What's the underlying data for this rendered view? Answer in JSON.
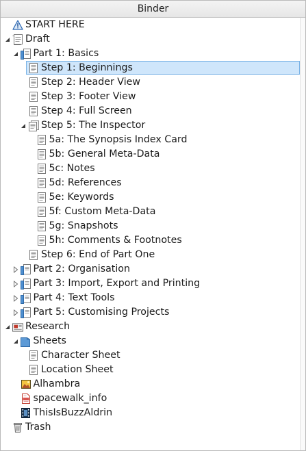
{
  "header": {
    "title": "Binder"
  },
  "items": [
    {
      "label": "START HERE",
      "depth": 0,
      "icon": "warning-icon",
      "toggle": "none"
    },
    {
      "label": "Draft",
      "depth": 0,
      "icon": "draft-icon",
      "toggle": "expanded"
    },
    {
      "label": "Part 1: Basics",
      "depth": 1,
      "icon": "folder-doc-icon",
      "toggle": "expanded"
    },
    {
      "label": "Step 1: Beginnings",
      "depth": 2,
      "icon": "document-icon",
      "toggle": "none",
      "selected": true
    },
    {
      "label": "Step 2: Header View",
      "depth": 2,
      "icon": "document-icon",
      "toggle": "none"
    },
    {
      "label": "Step 3: Footer View",
      "depth": 2,
      "icon": "document-icon",
      "toggle": "none"
    },
    {
      "label": "Step 4: Full Screen",
      "depth": 2,
      "icon": "document-icon",
      "toggle": "none"
    },
    {
      "label": "Step 5: The Inspector",
      "depth": 2,
      "icon": "document-stack-icon",
      "toggle": "expanded"
    },
    {
      "label": "5a: The Synopsis Index Card",
      "depth": 3,
      "icon": "document-icon",
      "toggle": "none"
    },
    {
      "label": "5b: General Meta-Data",
      "depth": 3,
      "icon": "document-icon",
      "toggle": "none"
    },
    {
      "label": "5c: Notes",
      "depth": 3,
      "icon": "document-icon",
      "toggle": "none"
    },
    {
      "label": "5d: References",
      "depth": 3,
      "icon": "document-icon",
      "toggle": "none"
    },
    {
      "label": "5e: Keywords",
      "depth": 3,
      "icon": "document-icon",
      "toggle": "none"
    },
    {
      "label": "5f: Custom Meta-Data",
      "depth": 3,
      "icon": "document-icon",
      "toggle": "none"
    },
    {
      "label": "5g: Snapshots",
      "depth": 3,
      "icon": "document-icon",
      "toggle": "none"
    },
    {
      "label": "5h: Comments & Footnotes",
      "depth": 3,
      "icon": "document-icon",
      "toggle": "none"
    },
    {
      "label": "Step 6: End of Part One",
      "depth": 2,
      "icon": "document-icon",
      "toggle": "none"
    },
    {
      "label": "Part 2: Organisation",
      "depth": 1,
      "icon": "folder-doc-icon",
      "toggle": "collapsed"
    },
    {
      "label": "Part 3: Import, Export and Printing",
      "depth": 1,
      "icon": "folder-doc-icon",
      "toggle": "collapsed"
    },
    {
      "label": "Part 4: Text Tools",
      "depth": 1,
      "icon": "folder-doc-icon",
      "toggle": "collapsed"
    },
    {
      "label": "Part 5: Customising Projects",
      "depth": 1,
      "icon": "folder-doc-icon",
      "toggle": "collapsed"
    },
    {
      "label": "Research",
      "depth": 0,
      "icon": "research-icon",
      "toggle": "expanded"
    },
    {
      "label": "Sheets",
      "depth": 1,
      "icon": "folder-icon",
      "toggle": "expanded"
    },
    {
      "label": "Character Sheet",
      "depth": 2,
      "icon": "document-icon",
      "toggle": "none"
    },
    {
      "label": "Location Sheet",
      "depth": 2,
      "icon": "document-icon",
      "toggle": "none"
    },
    {
      "label": "Alhambra",
      "depth": 1,
      "icon": "image-icon",
      "toggle": "none"
    },
    {
      "label": "spacewalk_info",
      "depth": 1,
      "icon": "pdf-icon",
      "toggle": "none"
    },
    {
      "label": "ThisIsBuzzAldrin",
      "depth": 1,
      "icon": "movie-icon",
      "toggle": "none"
    },
    {
      "label": "Trash",
      "depth": 0,
      "icon": "trash-icon",
      "toggle": "none"
    }
  ]
}
